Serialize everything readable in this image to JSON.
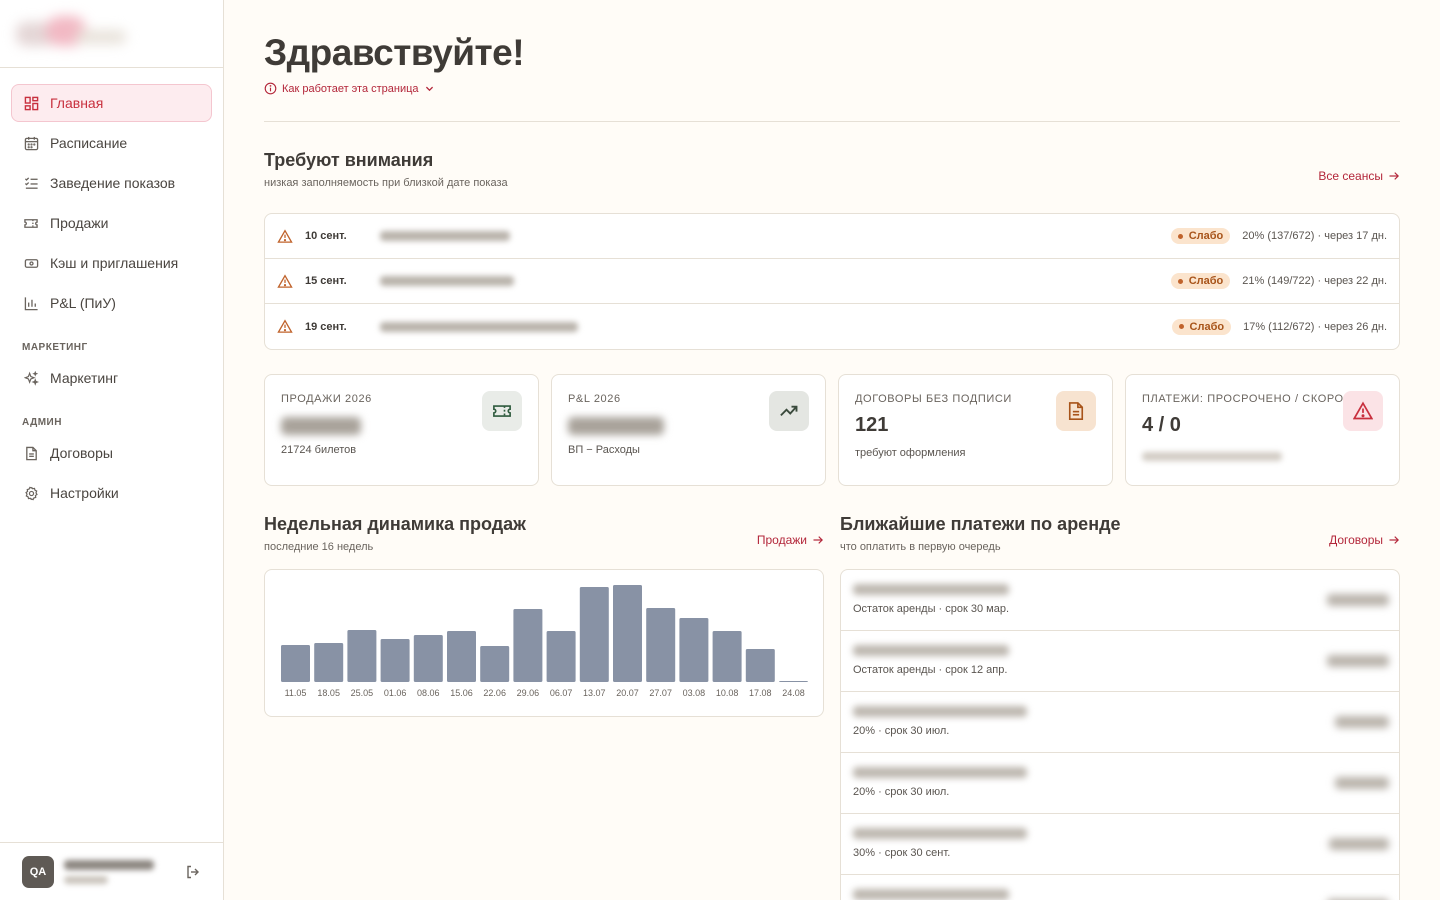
{
  "sidebar": {
    "items": [
      {
        "label": "Главная",
        "icon": "dashboard-icon",
        "active": true
      },
      {
        "label": "Расписание",
        "icon": "calendar-icon"
      },
      {
        "label": "Заведение показов",
        "icon": "list-check-icon"
      },
      {
        "label": "Продажи",
        "icon": "ticket-icon"
      },
      {
        "label": "Кэш и приглашения",
        "icon": "cash-icon"
      },
      {
        "label": "P&L (ПиУ)",
        "icon": "bar-chart-icon"
      }
    ],
    "sections": [
      {
        "title": "МАРКЕТИНГ",
        "items": [
          {
            "label": "Маркетинг",
            "icon": "sparkles-icon"
          }
        ]
      },
      {
        "title": "АДМИН",
        "items": [
          {
            "label": "Договоры",
            "icon": "document-icon"
          },
          {
            "label": "Настройки",
            "icon": "gear-icon"
          }
        ]
      }
    ],
    "user": {
      "initials": "QA"
    }
  },
  "header": {
    "title": "Здравствуйте!",
    "howto": "Как работает эта страница"
  },
  "attention": {
    "title": "Требуют внимания",
    "subtitle": "низкая заполняемость при близкой дате показа",
    "link": "Все сеансы",
    "rows": [
      {
        "date": "10 сент.",
        "badge": "Слабо",
        "stat": "20% (137/672) · через 17 дн."
      },
      {
        "date": "15 сент.",
        "badge": "Слабо",
        "stat": "21% (149/722) · через 22 дн."
      },
      {
        "date": "19 сент.",
        "badge": "Слабо",
        "stat": "17% (112/672) · через 26 дн."
      }
    ]
  },
  "cards": [
    {
      "label": "ПРОДАЖИ 2026",
      "value": "",
      "sub": "21724 билетов",
      "icon": "ticket-icon",
      "icon_bg": "#e9ece8",
      "icon_color": "#2f5b3e"
    },
    {
      "label": "P&L 2026",
      "value": "",
      "sub": "ВП − Расходы",
      "icon": "trending-up-icon",
      "icon_bg": "#e4e6e2",
      "icon_color": "#3a4a3c"
    },
    {
      "label": "ДОГОВОРЫ БЕЗ ПОДПИСИ",
      "value": "121",
      "sub": "требуют оформления",
      "icon": "document-icon",
      "icon_bg": "#f7e3d0",
      "icon_color": "#a8541a"
    },
    {
      "label": "ПЛАТЕЖИ: ПРОСРОЧЕНО / СКОРО",
      "value": "4 / 0",
      "sub": "",
      "icon": "alert-triangle-icon",
      "icon_bg": "#fbe3e6",
      "icon_color": "#c8303e"
    }
  ],
  "sales": {
    "title": "Недельная динамика продаж",
    "subtitle": "последние 16 недель",
    "link": "Продажи"
  },
  "chart_data": {
    "type": "bar",
    "categories": [
      "11.05",
      "18.05",
      "25.05",
      "01.06",
      "08.06",
      "15.06",
      "22.06",
      "29.06",
      "06.07",
      "13.07",
      "20.07",
      "27.07",
      "03.08",
      "10.08",
      "17.08",
      "24.08"
    ],
    "values": [
      37,
      39,
      52,
      43,
      47,
      51,
      36,
      73,
      51,
      95,
      97,
      74,
      64,
      51,
      33,
      1
    ],
    "ylim": [
      0,
      100
    ],
    "bar_color": "#8892a5",
    "grid": false
  },
  "payments": {
    "title": "Ближайшие платежи по аренде",
    "subtitle": "что оплатить в первую очередь",
    "link": "Договоры",
    "rows": [
      {
        "sub": "Остаток аренды · срок 30 мар."
      },
      {
        "sub": "Остаток аренды · срок 12 апр."
      },
      {
        "sub": "20% · срок 30 июл."
      },
      {
        "sub": "20% · срок 30 июл."
      },
      {
        "sub": "30% · срок 30 сент."
      },
      {
        "sub": ""
      }
    ]
  }
}
